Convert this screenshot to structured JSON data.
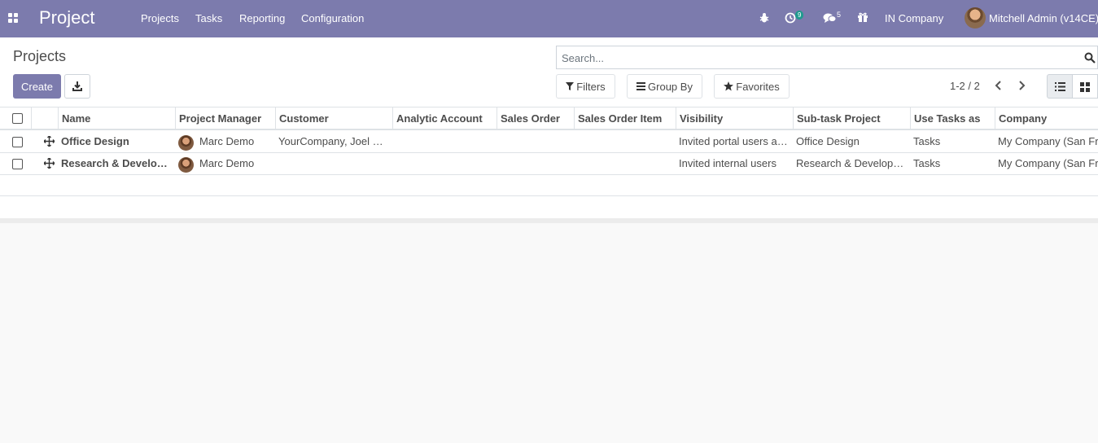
{
  "navbar": {
    "app_name": "Project",
    "menu": [
      "Projects",
      "Tasks",
      "Reporting",
      "Configuration"
    ],
    "activity_count": "9",
    "message_count": "5",
    "company": "IN Company",
    "user": "Mitchell Admin (v14CE)",
    "icons": [
      "apps-grid-icon",
      "bug-icon",
      "clock-icon",
      "chat-icon",
      "gift-icon"
    ]
  },
  "control": {
    "breadcrumb": "Projects",
    "create_label": "Create",
    "search_placeholder": "Search...",
    "filters_label": "Filters",
    "group_by_label": "Group By",
    "favorites_label": "Favorites",
    "pager": "1-2 / 2"
  },
  "table": {
    "columns": [
      "Name",
      "Project Manager",
      "Customer",
      "Analytic Account",
      "Sales Order",
      "Sales Order Item",
      "Visibility",
      "Sub-task Project",
      "Use Tasks as",
      "Company"
    ],
    "rows": [
      {
        "name": "Office Design",
        "manager": "Marc Demo",
        "customer": "YourCompany, Joel Willis",
        "analytic_account": "",
        "sales_order": "",
        "sales_order_item": "",
        "visibility": "Invited portal users and all internal users",
        "subtask_project": "Office Design",
        "use_tasks_as": "Tasks",
        "company": "My Company (San Francisco)"
      },
      {
        "name": "Research & Development",
        "manager": "Marc Demo",
        "customer": "",
        "analytic_account": "",
        "sales_order": "",
        "sales_order_item": "",
        "visibility": "Invited internal users",
        "subtask_project": "Research & Development",
        "use_tasks_as": "Tasks",
        "company": "My Company (San Francisco)"
      }
    ]
  },
  "colors": {
    "brand": "#7c7bad",
    "badge": "#1f9a8e"
  }
}
